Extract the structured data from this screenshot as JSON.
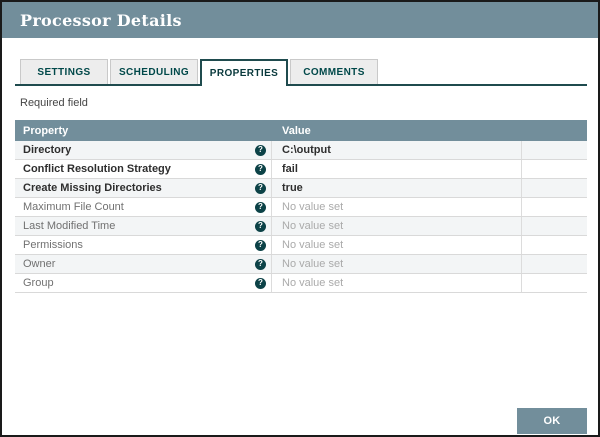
{
  "window": {
    "title": "Processor Details"
  },
  "tabs": [
    {
      "label": "SETTINGS",
      "active": false
    },
    {
      "label": "SCHEDULING",
      "active": false
    },
    {
      "label": "PROPERTIES",
      "active": true
    },
    {
      "label": "COMMENTS",
      "active": false
    }
  ],
  "required_note": "Required field",
  "table": {
    "columns": [
      "Property",
      "Value"
    ],
    "help_icon_glyph": "?",
    "rows": [
      {
        "property": "Directory",
        "value": "C:\\output",
        "required": true
      },
      {
        "property": "Conflict Resolution Strategy",
        "value": "fail",
        "required": true
      },
      {
        "property": "Create Missing Directories",
        "value": "true",
        "required": true
      },
      {
        "property": "Maximum File Count",
        "value": "No value set",
        "required": false
      },
      {
        "property": "Last Modified Time",
        "value": "No value set",
        "required": false
      },
      {
        "property": "Permissions",
        "value": "No value set",
        "required": false
      },
      {
        "property": "Owner",
        "value": "No value set",
        "required": false
      },
      {
        "property": "Group",
        "value": "No value set",
        "required": false
      }
    ]
  },
  "footer": {
    "ok_label": "OK"
  },
  "colors": {
    "header_bg": "#728E9B",
    "tab_text": "#004849",
    "tab_active_border": "#1f4b4e",
    "help_icon_bg": "#0c4247",
    "row_alt_bg": "#f3f5f6",
    "window_border": "#1a1a1a"
  }
}
